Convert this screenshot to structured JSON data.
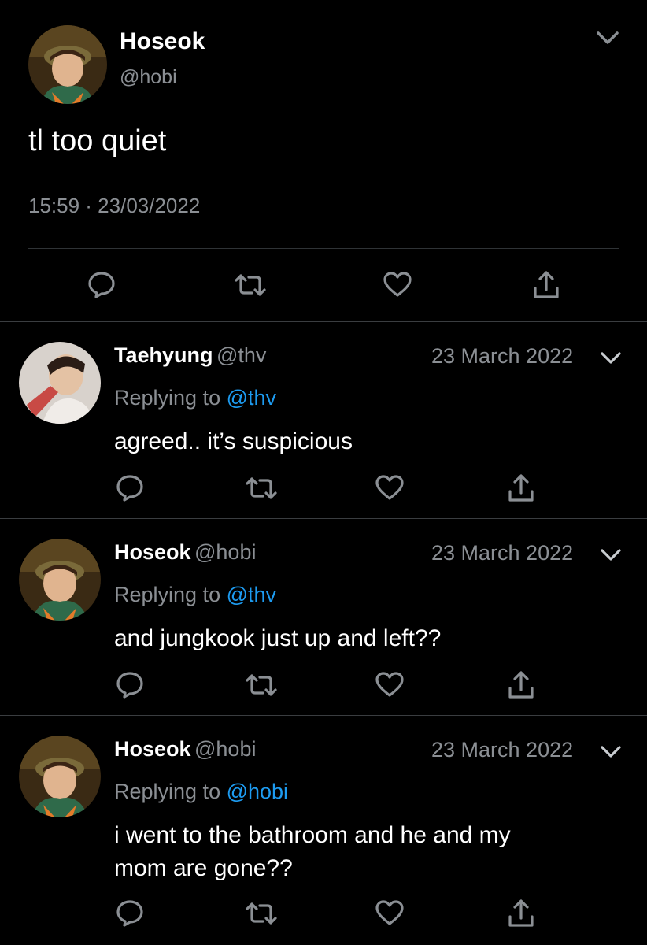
{
  "main_tweet": {
    "name": "Hoseok",
    "handle": "@hobi",
    "text": "tl too quiet",
    "timestamp": "15:59 · 23/03/2022"
  },
  "replies": [
    {
      "name": "Taehyung",
      "handle": "@thv",
      "date": "23 March 2022",
      "replying_prefix": "Replying to ",
      "replying_to": "@thv",
      "text": "agreed.. it’s suspicious"
    },
    {
      "name": "Hoseok",
      "handle": "@hobi",
      "date": "23 March 2022",
      "replying_prefix": "Replying to ",
      "replying_to": "@thv",
      "text": "and jungkook just up and left??"
    },
    {
      "name": "Hoseok",
      "handle": "@hobi",
      "date": "23 March 2022",
      "replying_prefix": "Replying to ",
      "replying_to": "@hobi",
      "text_line1": "i went to the bathroom and he and my",
      "text_line2": "mom are gone??"
    }
  ],
  "icons": {
    "reply": "reply-icon",
    "retweet": "retweet-icon",
    "like": "like-icon",
    "share": "share-icon",
    "more": "chevron-down-icon"
  },
  "colors": {
    "background": "#000000",
    "mention": "#1d9bf0",
    "secondary_text": "#8b8f94"
  }
}
